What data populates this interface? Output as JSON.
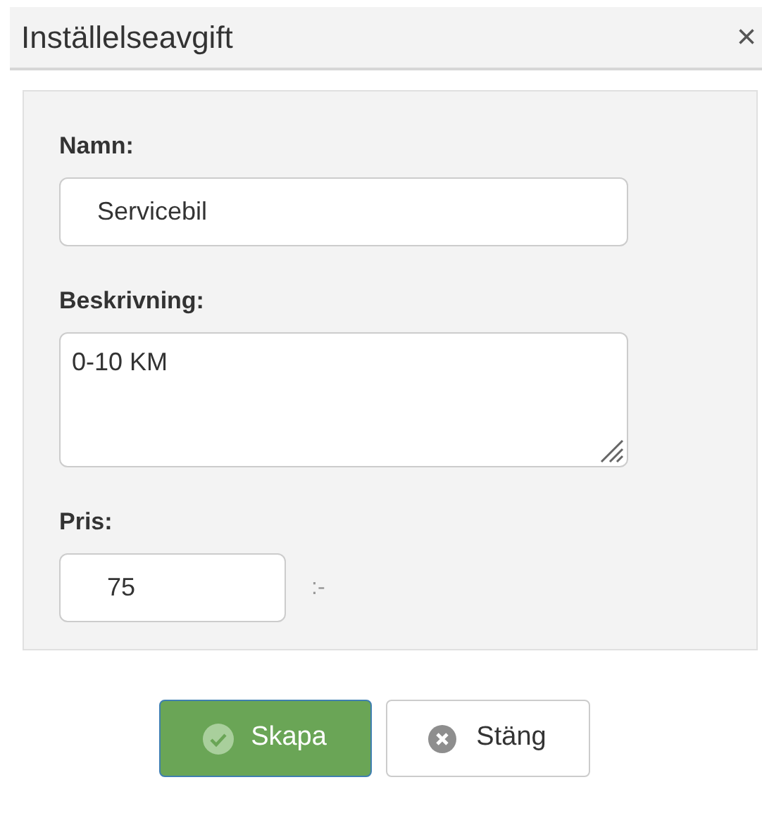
{
  "window": {
    "title": "Inställelseavgift",
    "close": "×"
  },
  "fields": [
    {
      "kind": "input",
      "label": "Namn:",
      "value": "Servicebil"
    },
    {
      "kind": "textarea",
      "label": "Beskrivning:",
      "value": "0-10 KM"
    },
    {
      "kind": "price",
      "label": "Pris:",
      "value": "75",
      "suffix": ":-"
    }
  ],
  "buttons": [
    {
      "kind": "primary",
      "label": "Skapa"
    },
    {
      "kind": "default",
      "label": "Stäng"
    }
  ]
}
